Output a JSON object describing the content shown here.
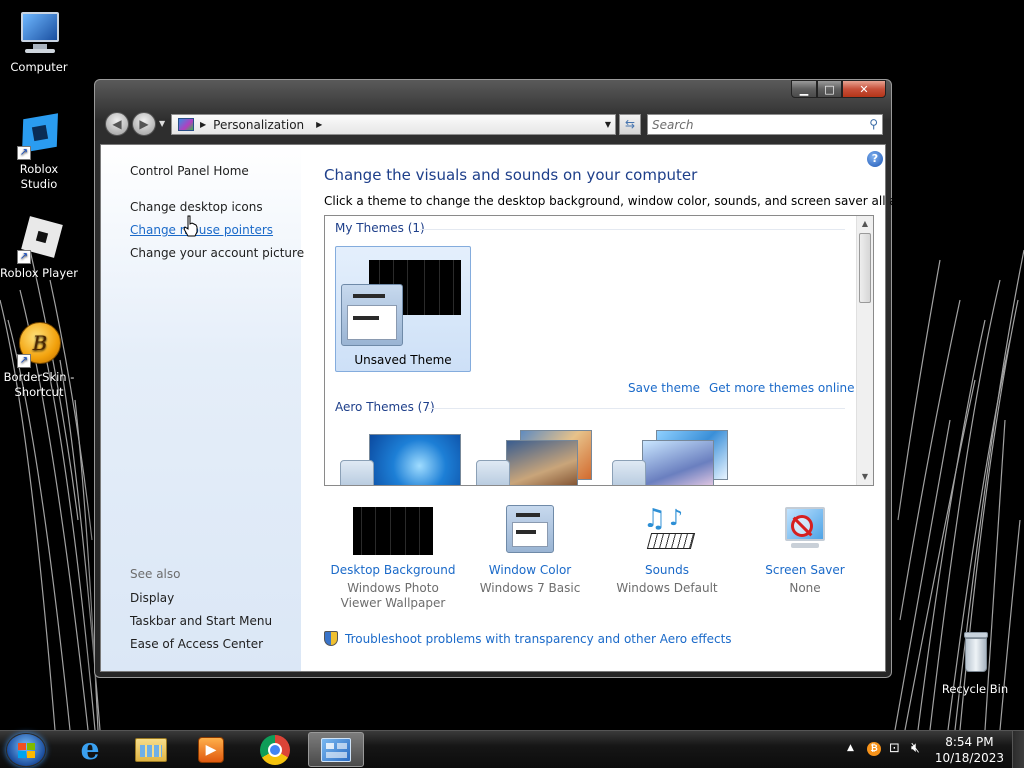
{
  "desktop": {
    "icons": [
      {
        "label": "Computer"
      },
      {
        "label": "Roblox Studio"
      },
      {
        "label": "Roblox Player"
      },
      {
        "label": "BorderSkin - Shortcut"
      },
      {
        "label": "Recycle Bin"
      }
    ]
  },
  "window": {
    "address": {
      "crumb": "Personalization"
    },
    "search": {
      "placeholder": "Search"
    },
    "left_panel": {
      "home": "Control Panel Home",
      "links": [
        "Change desktop icons",
        "Change mouse pointers",
        "Change your account picture"
      ],
      "see_also_label": "See also",
      "see_also": [
        "Display",
        "Taskbar and Start Menu",
        "Ease of Access Center"
      ]
    },
    "main": {
      "title": "Change the visuals and sounds on your computer",
      "subtitle": "Click a theme to change the desktop background, window color, sounds, and screen saver all at once.",
      "my_themes_label": "My Themes (1)",
      "unsaved_theme": "Unsaved Theme",
      "save_theme": "Save theme",
      "get_more": "Get more themes online",
      "aero_themes_label": "Aero Themes (7)",
      "options": [
        {
          "name": "Desktop Background",
          "sub": "Windows Photo Viewer Wallpaper"
        },
        {
          "name": "Window Color",
          "sub": "Windows 7 Basic"
        },
        {
          "name": "Sounds",
          "sub": "Windows Default"
        },
        {
          "name": "Screen Saver",
          "sub": "None"
        }
      ],
      "troubleshoot": "Troubleshoot problems with transparency and other Aero effects"
    }
  },
  "taskbar": {
    "pinned": [
      "start-orb-icon",
      "internet-explorer-icon",
      "file-explorer-icon",
      "media-player-icon",
      "chrome-icon",
      "personalization-icon"
    ],
    "clock": {
      "time": "8:54 PM",
      "date": "10/18/2023"
    }
  },
  "colors": {
    "link": "#1b6ac9",
    "heading": "#1e3f8a",
    "nav_pane": "#dbe7f6"
  }
}
